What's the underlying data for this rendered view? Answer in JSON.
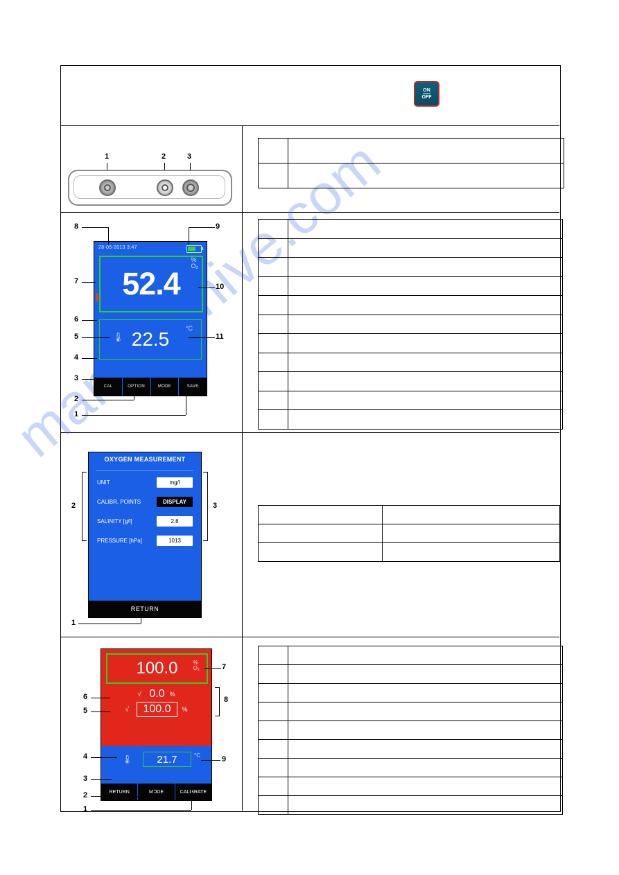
{
  "watermark": "manualshive.com",
  "onoff": {
    "top": "ON",
    "bottom": "OFF"
  },
  "fig1": {
    "labels": {
      "l1": "1",
      "l2": "2",
      "l3": "3"
    }
  },
  "fig2": {
    "datetime": "28-05-2013   3:47",
    "value1": "52.4",
    "unit1a": "%",
    "unit1b": "O₂",
    "value2": "22.5",
    "unit2": "°C",
    "buttons": [
      "CAL",
      "OPTION",
      "MODE",
      "SAVE"
    ],
    "callouts": {
      "n1": "1",
      "n2": "2",
      "n3": "3",
      "n4": "4",
      "n5": "5",
      "n6": "6",
      "n7": "7",
      "n8": "8",
      "n9": "9",
      "n10": "10",
      "n11": "11"
    }
  },
  "fig3": {
    "title": "OXYGEN MEASUREMENT",
    "rows": [
      {
        "label": "UNIT",
        "value": "mg/l",
        "dark": false
      },
      {
        "label": "CALIBR. POINTS",
        "value": "DISPLAY",
        "dark": true
      },
      {
        "label": "SALINITY  [g/l]",
        "value": "2.8",
        "dark": false
      },
      {
        "label": "PRESSURE  [hPa]",
        "value": "1013",
        "dark": false
      }
    ],
    "return": "RETURN",
    "callouts": {
      "n1": "1",
      "n2": "2",
      "n3": "3"
    }
  },
  "fig4": {
    "value1": "100.0",
    "unit1a": "%",
    "unit1b": "O₂",
    "rowA": {
      "val": "0.0",
      "pct": "%"
    },
    "rowB": {
      "val": "100.0",
      "pct": "%"
    },
    "temp": "21.7",
    "tunit": "°C",
    "buttons": [
      "RETURN",
      "MODE",
      "CALIBRATE"
    ],
    "callouts": {
      "n1": "1",
      "n2": "2",
      "n3": "3",
      "n4": "4",
      "n5": "5",
      "n6": "6",
      "n7": "7",
      "n8": "8",
      "n9": "9"
    }
  }
}
